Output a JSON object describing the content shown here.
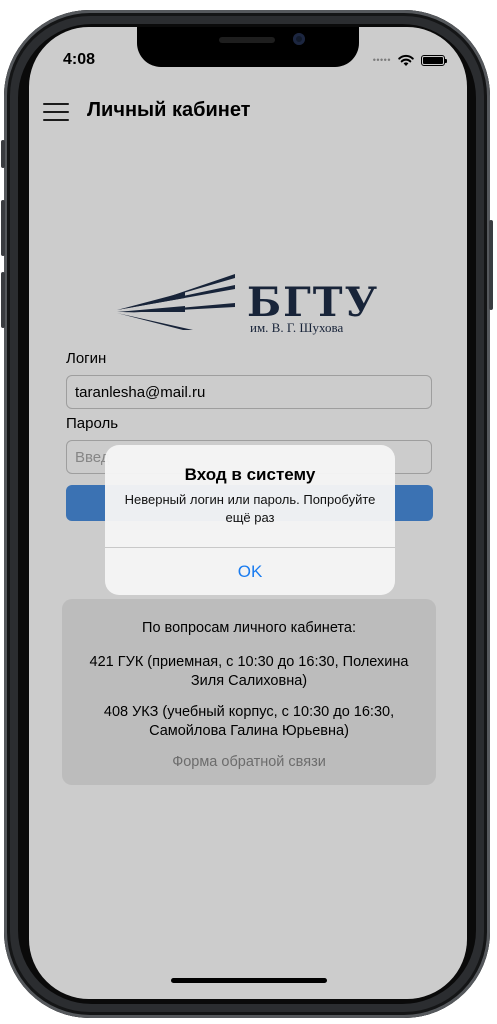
{
  "status_bar": {
    "time": "4:08",
    "signal_dots": "•••••"
  },
  "header": {
    "title": "Личный кабинет"
  },
  "logo": {
    "text": "БГТУ",
    "subtitle": "им. В. Г. Шухова"
  },
  "form": {
    "login_label": "Логин",
    "login_value": "taranlesha@mail.ru",
    "password_label": "Пароль",
    "password_placeholder": "Введ"
  },
  "info": {
    "heading": "По вопросам личного кабинета:",
    "contact1": "421 ГУК (приемная, с 10:30 до 16:30, Полехина Зиля Салиховна)",
    "contact2": "408 УКЗ (учебный корпус, с 10:30 до 16:30, Самойлова Галина Юрьевна)",
    "feedback_link": "Форма обратной связи"
  },
  "alert": {
    "title": "Вход в систему",
    "message": "Неверный логин или пароль. Попробуйте ещё раз",
    "ok_label": "OK"
  },
  "colors": {
    "accent": "#1a7cf0",
    "login_button": "#4a8fe0",
    "logo": "#1f2d48"
  },
  "icons": [
    "hamburger-menu-icon",
    "wifi-icon",
    "battery-icon",
    "bgtu-logo-icon"
  ]
}
